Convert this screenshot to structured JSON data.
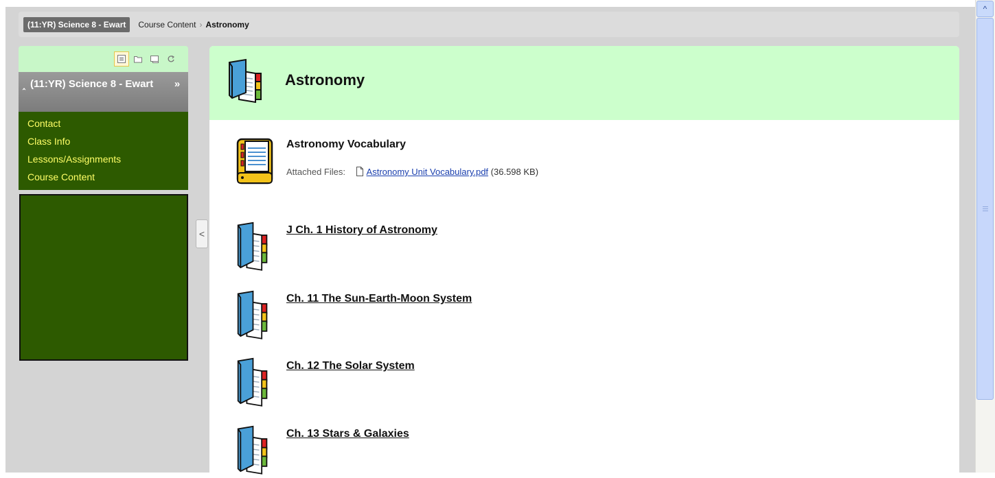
{
  "breadcrumb": {
    "course": "(11:YR) Science 8 - Ewart",
    "items": [
      "Course Content",
      "Astronomy"
    ],
    "separator": "›"
  },
  "sidebar": {
    "tool_icons": [
      "list-view-icon",
      "folder-view-icon",
      "window-view-icon",
      "refresh-icon"
    ],
    "course_name": "(11:YR) Science 8 - Ewart",
    "collapse_glyph": "‸",
    "expand_glyph": "»",
    "menu_items": [
      {
        "label": "Contact"
      },
      {
        "label": "Class Info"
      },
      {
        "label": "Lessons/Assignments"
      },
      {
        "label": "Course Content"
      }
    ],
    "collapse_tab_glyph": "<"
  },
  "main": {
    "title": "Astronomy",
    "items": [
      {
        "title": "Astronomy Vocabulary",
        "icon": "document-item-icon",
        "attached_label": "Attached Files:",
        "file_name": "Astronomy Unit Vocabulary.pdf",
        "file_size": "(36.598 KB)"
      },
      {
        "title": "J Ch. 1 History of Astronomy",
        "icon": "content-folder-icon"
      },
      {
        "title": "Ch. 11 The Sun-Earth-Moon System",
        "icon": "content-folder-icon"
      },
      {
        "title": "Ch. 12 The Solar System",
        "icon": "content-folder-icon"
      },
      {
        "title": "Ch. 13 Stars & Galaxies",
        "icon": "content-folder-icon"
      }
    ]
  },
  "scrollbar": {
    "up_glyph": "^"
  },
  "colors": {
    "menu_bg": "#2d5a00",
    "menu_text": "#ffff66",
    "header_green": "#ccffcc",
    "link_blue": "#1a3fae"
  }
}
